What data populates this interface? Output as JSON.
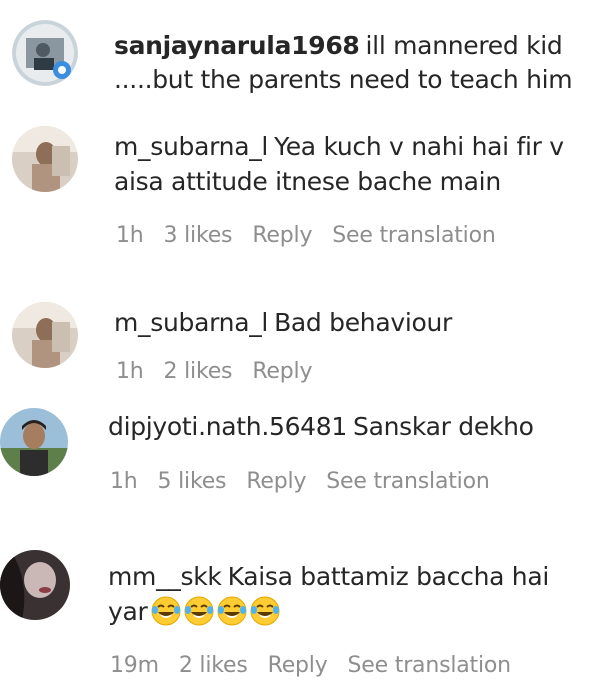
{
  "comments": [
    {
      "username": "sanjaynarula1968",
      "line1": "ill mannered kid",
      "line2": ".....but the parents need to teach him",
      "avatar": "avatar-man-with-badge"
    },
    {
      "username": "m_subarna_l",
      "line1": "Yea kuch v nahi hai fir v",
      "line2": "aisa attitude itnese bache main",
      "time": "1h",
      "likes": "3 likes",
      "reply": "Reply",
      "translate": "See translation",
      "avatar": "avatar-woman"
    },
    {
      "username": "m_subarna_l",
      "line1": "Bad behaviour",
      "time": "1h",
      "likes": "2 likes",
      "reply": "Reply",
      "avatar": "avatar-woman"
    },
    {
      "username": "dipjyoti.nath.56481",
      "line1": "Sanskar dekho",
      "time": "1h",
      "likes": "5 likes",
      "reply": "Reply",
      "translate": "See translation",
      "avatar": "avatar-man-outdoor"
    },
    {
      "username": "mm__skk",
      "line1": "Kaisa battamiz baccha hai",
      "line2": "yar",
      "emoji": "laughing-crying-emoji",
      "emoji_count": 4,
      "time": "19m",
      "likes": "2 likes",
      "reply": "Reply",
      "translate": "See translation",
      "avatar": "avatar-dark-profile"
    }
  ],
  "colors": {
    "text": "#262626",
    "meta": "#8e8e8e",
    "username": "#262626"
  }
}
